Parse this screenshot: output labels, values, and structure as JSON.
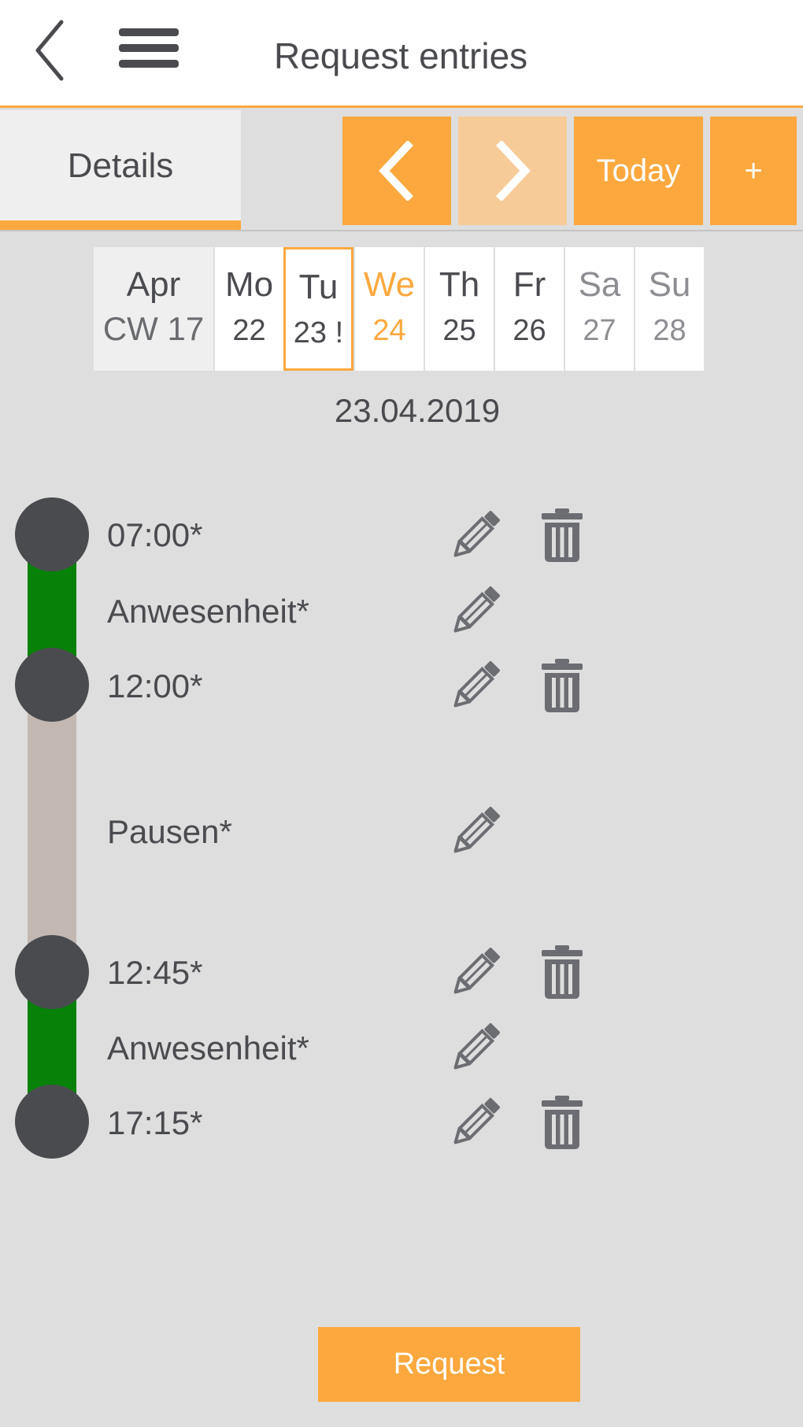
{
  "header": {
    "title": "Request entries"
  },
  "toolbar": {
    "tab_details": "Details",
    "today_label": "Today",
    "add_label": "+"
  },
  "week": {
    "month": "Apr",
    "calendar_week": "CW 17",
    "days": [
      {
        "name": "Mo",
        "date": "22"
      },
      {
        "name": "Tu",
        "date": "23 !"
      },
      {
        "name": "We",
        "date": "24"
      },
      {
        "name": "Th",
        "date": "25"
      },
      {
        "name": "Fr",
        "date": "26"
      },
      {
        "name": "Sa",
        "date": "27"
      },
      {
        "name": "Su",
        "date": "28"
      }
    ]
  },
  "selected_date": "23.04.2019",
  "timeline": {
    "rows": [
      {
        "label": "07:00*"
      },
      {
        "label": "Anwesenheit*"
      },
      {
        "label": "12:00*"
      },
      {
        "label": "Pausen*"
      },
      {
        "label": "12:45*"
      },
      {
        "label": "Anwesenheit*"
      },
      {
        "label": "17:15*"
      }
    ]
  },
  "actions": {
    "request_label": "Request"
  },
  "colors": {
    "accent": "#fca83e",
    "accent_disabled": "#f6cb97",
    "presence": "#088108",
    "pause": "#c3b7b1",
    "marker": "#4a4b4f"
  }
}
